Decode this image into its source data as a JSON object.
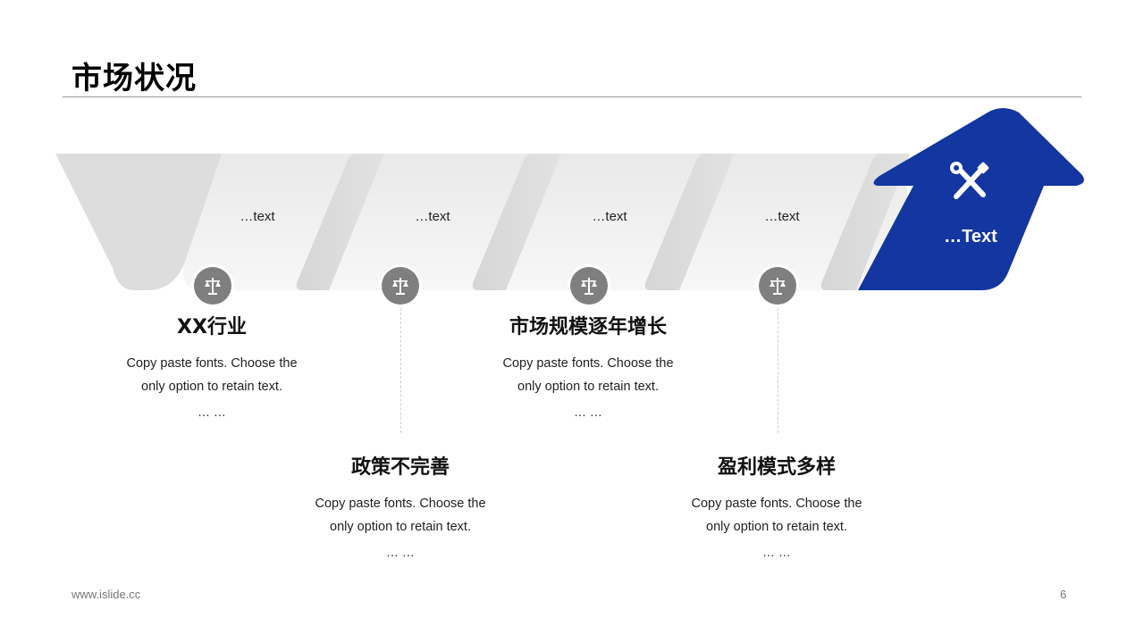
{
  "page": {
    "title": "市场状况",
    "footer_url": "www.islide.cc",
    "page_number": "6"
  },
  "band": {
    "segments": [
      {
        "label": "…text"
      },
      {
        "label": "…text"
      },
      {
        "label": "…text"
      },
      {
        "label": "…text"
      }
    ],
    "arrow": {
      "label": "…Text",
      "icon": "wrench-screwdriver-icon",
      "color": "#1336a0"
    }
  },
  "markers": {
    "icon": "scales-icon",
    "color": "#7f7f7f"
  },
  "cards": [
    {
      "heading": "XX行业",
      "line1": "Copy paste fonts. Choose the",
      "line2": "only option to retain text.",
      "dots": "… …"
    },
    {
      "heading": "政策不完善",
      "line1": "Copy paste fonts. Choose the",
      "line2": "only option to retain text.",
      "dots": "… …"
    },
    {
      "heading": "市场规模逐年增长",
      "line1": "Copy paste fonts. Choose the",
      "line2": "only option to retain text.",
      "dots": "… …"
    },
    {
      "heading": "盈利模式多样",
      "line1": "Copy paste fonts. Choose the",
      "line2": "only option to retain text.",
      "dots": "… …"
    }
  ]
}
